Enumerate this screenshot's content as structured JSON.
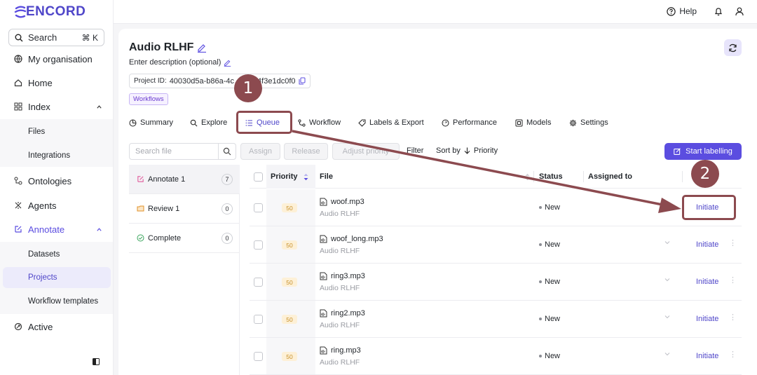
{
  "app": {
    "logo_text": "ENCORD"
  },
  "search": {
    "label": "Search",
    "shortcut": "⌘ K"
  },
  "sidebar": {
    "items": [
      {
        "label": "My organisation",
        "icon": "globe-icon"
      },
      {
        "label": "Home",
        "icon": "home-icon"
      },
      {
        "label": "Index",
        "icon": "grid-icon"
      },
      {
        "label": "Files"
      },
      {
        "label": "Integrations"
      },
      {
        "label": "Ontologies",
        "icon": "ontology-icon"
      },
      {
        "label": "Agents",
        "icon": "agents-icon"
      },
      {
        "label": "Annotate",
        "icon": "annotate-icon"
      },
      {
        "label": "Datasets"
      },
      {
        "label": "Projects"
      },
      {
        "label": "Workflow templates"
      },
      {
        "label": "Active",
        "icon": "active-icon"
      }
    ]
  },
  "topbar": {
    "help": "Help"
  },
  "project": {
    "title": "Audio RLHF",
    "description": "Enter description (optional)",
    "id_label": "Project ID:",
    "id_value": "40030d5a-b86a-4c…8-9e4f3e1dc0f0",
    "badge": "Workflows"
  },
  "tabs": [
    "Summary",
    "Explore",
    "Queue",
    "Workflow",
    "Labels & Export",
    "Performance",
    "Models",
    "Settings"
  ],
  "active_tab": "Queue",
  "toolbar": {
    "search_placeholder": "Search file",
    "assign": "Assign",
    "release": "Release",
    "adjust_priority": "Adjust priority",
    "filter": "Filter",
    "sort_by": "Sort by",
    "sort_field": "Priority",
    "start_labelling": "Start labelling"
  },
  "stages": [
    {
      "label": "Annotate 1",
      "count": "7"
    },
    {
      "label": "Review 1",
      "count": "0"
    },
    {
      "label": "Complete",
      "count": "0"
    }
  ],
  "table": {
    "headers": {
      "priority": "Priority",
      "file": "File",
      "status": "Status",
      "assigned_to": "Assigned to"
    },
    "rows": [
      {
        "priority": "50",
        "file": "woof.mp3",
        "project": "Audio RLHF",
        "status": "New",
        "action": "Initiate"
      },
      {
        "priority": "50",
        "file": "woof_long.mp3",
        "project": "Audio RLHF",
        "status": "New",
        "action": "Initiate"
      },
      {
        "priority": "50",
        "file": "ring3.mp3",
        "project": "Audio RLHF",
        "status": "New",
        "action": "Initiate"
      },
      {
        "priority": "50",
        "file": "ring2.mp3",
        "project": "Audio RLHF",
        "status": "New",
        "action": "Initiate"
      },
      {
        "priority": "50",
        "file": "ring.mp3",
        "project": "Audio RLHF",
        "status": "New",
        "action": "Initiate"
      }
    ]
  },
  "annotations": {
    "step1": "1",
    "step2": "2",
    "color": "#8c4a4f"
  },
  "colors": {
    "accent": "#5b4de0",
    "priority_badge": "#fdf0d7"
  }
}
